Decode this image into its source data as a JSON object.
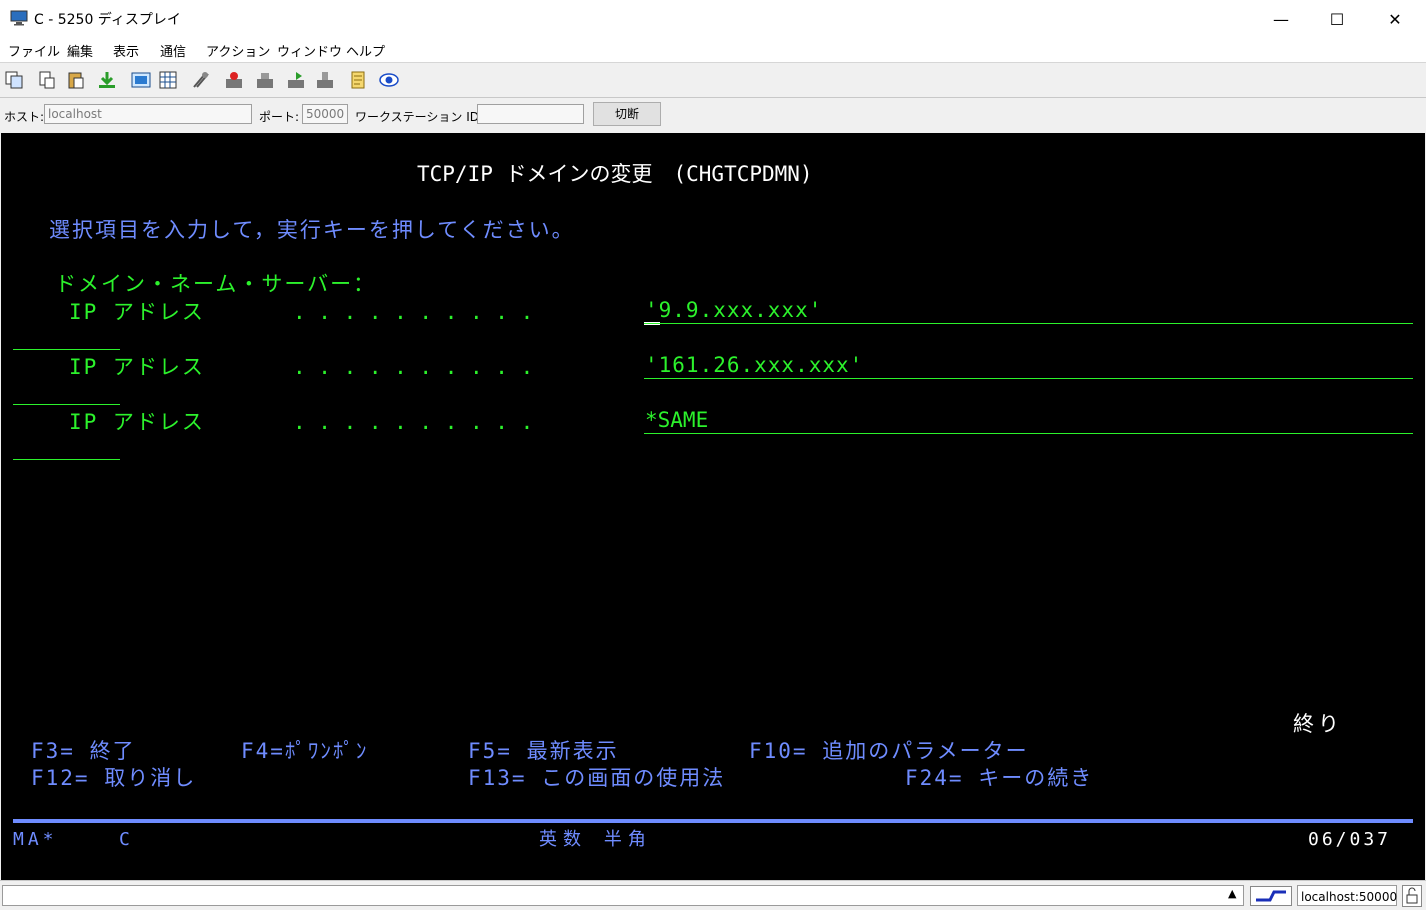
{
  "window": {
    "title": "C - 5250 ディスプレイ",
    "minimize": "—",
    "maximize": "☐",
    "close": "✕"
  },
  "menu": [
    "ファイル",
    "編集",
    "表示",
    "通信",
    "アクション",
    "ウィンドウ",
    "ヘルプ"
  ],
  "toolbar_icons": [
    "copy-icon",
    "cut-icon",
    "paste-icon",
    "receive-file-icon",
    "macro-icon",
    "grid-icon",
    "settings-icon",
    "record-icon",
    "print-icon",
    "send-icon",
    "stop-icon",
    "notes-icon",
    "help-icon"
  ],
  "connection": {
    "host_label": "ホスト:",
    "host_value": "localhost",
    "port_label": "ポート:",
    "port_value": "50000",
    "workstation_label": "ワークステーション ID:",
    "workstation_value": "",
    "disconnect_label": "切断"
  },
  "screen": {
    "title": "TCP/IP ドメインの変更　(CHGTCPDMN)",
    "instruction": "選択項目を入力して，実行キーを押してください。",
    "section_label": "ドメイン・ネーム・サーバー：",
    "fields": [
      {
        "label": "IP アドレス",
        "dots": ". . . . . . . . . .",
        "value": "'9.9.xxx.xxx'"
      },
      {
        "label": "IP アドレス",
        "dots": ". . . . . . . . . .",
        "value": "'161.26.xxx.xxx'"
      },
      {
        "label": "IP アドレス",
        "dots": ". . . . . . . . . .",
        "value": "*SAME"
      }
    ],
    "more_indicator": "終り",
    "function_keys": {
      "f3": "F3= 終了",
      "f4": "F4=ﾎﾟﾜﾝﾎﾟﾝ",
      "f5": "F5= 最新表示",
      "f10": "F10= 追加のパラメーター",
      "f12": "F12= 取り消し",
      "f13": "F13= この画面の使用法",
      "f24": "F24= キーの続き"
    },
    "oia": {
      "left": "MA*",
      "session": "C",
      "input_mode": "英数 半角",
      "cursor_pos": "06/037"
    }
  },
  "statusbar": {
    "connection": "localhost:50000"
  },
  "colors": {
    "screen_bg": "#000000",
    "screen_green": "#2cf22c",
    "screen_blue": "#6f8cff",
    "screen_white": "#ffffff"
  }
}
